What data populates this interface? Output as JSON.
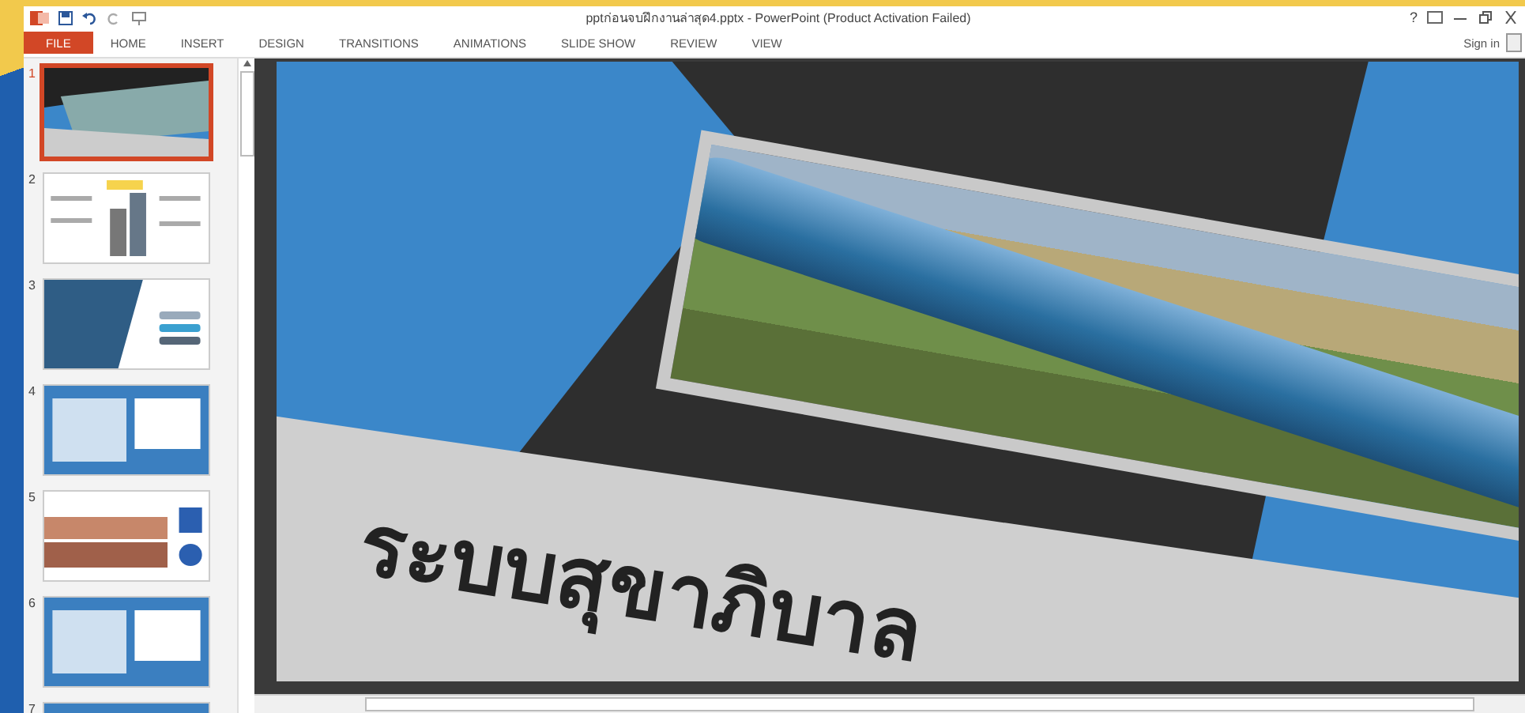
{
  "window": {
    "title": "pptก่อนจบฝึกงานล่าสุด4.pptx - PowerPoint (Product Activation Failed)",
    "help": "?"
  },
  "ribbon_tabs": [
    {
      "label": "FILE",
      "selected": true
    },
    {
      "label": "HOME",
      "selected": false
    },
    {
      "label": "INSERT",
      "selected": false
    },
    {
      "label": "DESIGN",
      "selected": false
    },
    {
      "label": "TRANSITIONS",
      "selected": false
    },
    {
      "label": "ANIMATIONS",
      "selected": false
    },
    {
      "label": "SLIDE SHOW",
      "selected": false
    },
    {
      "label": "REVIEW",
      "selected": false
    },
    {
      "label": "VIEW",
      "selected": false
    }
  ],
  "sign_in": "Sign in",
  "thumbnails": [
    {
      "number": "1",
      "selected": true,
      "kind": "title"
    },
    {
      "number": "2",
      "selected": false,
      "kind": "chart"
    },
    {
      "number": "3",
      "selected": false,
      "kind": "dark"
    },
    {
      "number": "4",
      "selected": false,
      "kind": "blue"
    },
    {
      "number": "5",
      "selected": false,
      "kind": "brown"
    },
    {
      "number": "6",
      "selected": false,
      "kind": "blue"
    },
    {
      "number": "7",
      "selected": false,
      "kind": "blue"
    }
  ],
  "slide": {
    "title": "ระบบสุขาภิบาล"
  }
}
